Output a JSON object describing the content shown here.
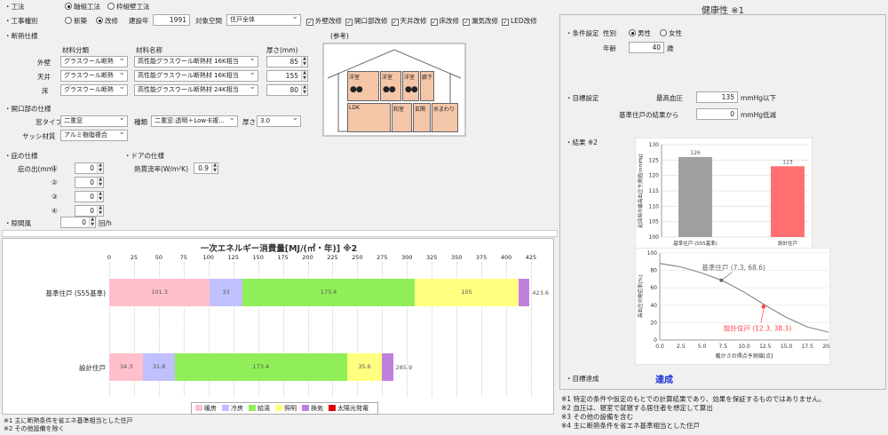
{
  "construction": {
    "label": "工法",
    "options": [
      "軸組工法",
      "枠組壁工法"
    ],
    "selected": 0
  },
  "work_type": {
    "label": "工事種別",
    "options": [
      "新築",
      "改修"
    ],
    "selected": 1,
    "year_label": "建設年",
    "year_value": "1991",
    "space_label": "対象空間",
    "space_value": "住戸全体",
    "checks": [
      {
        "label": "外壁改修",
        "checked": true
      },
      {
        "label": "開口部改修",
        "checked": true
      },
      {
        "label": "天井改修",
        "checked": true
      },
      {
        "label": "床改修",
        "checked": true
      },
      {
        "label": "漏気改修",
        "checked": true
      },
      {
        "label": "LED改修",
        "checked": true
      }
    ]
  },
  "insulation": {
    "title": "断熱仕様",
    "col_material_type": "材料分類",
    "col_material_name": "材料名称",
    "col_thickness": "厚さ(mm)",
    "reference": "(参考)",
    "rows": [
      {
        "label": "外壁",
        "type": "グラスウール断熱材",
        "name": "高性能グラスウール断熱材 16K相当",
        "thickness": "85"
      },
      {
        "label": "天井",
        "type": "グラスウール断熱材",
        "name": "高性能グラスウール断熱材 16K相当",
        "thickness": "155"
      },
      {
        "label": "床",
        "type": "グラスウール断熱材",
        "name": "高性能グラスウール断熱材 24K相当",
        "thickness": "80"
      }
    ]
  },
  "opening": {
    "title": "開口部の仕様",
    "window_type_label": "窓タイプ",
    "window_type_value": "二重窓",
    "kind_label": "種類",
    "kind_value": "二重窓:透明＋Low-E複...",
    "thickness_label": "厚さ",
    "thickness_value": "3.0",
    "sash_label": "サッシ材質",
    "sash_value": "アルミ樹脂複合"
  },
  "eaves": {
    "title": "庇の仕様",
    "depth_label": "庇の出(mm)",
    "rows": [
      {
        "label": "①",
        "value": "0"
      },
      {
        "label": "②",
        "value": "0"
      },
      {
        "label": "③",
        "value": "0"
      },
      {
        "label": "④",
        "value": "0"
      }
    ]
  },
  "door": {
    "title": "ドアの仕様",
    "heat_label": "熱貫流率(W/m²K)",
    "heat_value": "0.9"
  },
  "draft": {
    "label": "隙間風",
    "value": "0",
    "unit": "回/h"
  },
  "house_rooms": {
    "upper": [
      "洋室",
      "洋室",
      "洋室",
      "廊下"
    ],
    "lower": [
      "LDK",
      "和室",
      "玄関",
      "水まわり"
    ]
  },
  "energy_chart": {
    "title": "一次エネルギー消費量[MJ/(㎡・年)] ※2",
    "ticks": [
      "0",
      "25",
      "50",
      "75",
      "100",
      "125",
      "150",
      "175",
      "200",
      "225",
      "250",
      "275",
      "300",
      "325",
      "350",
      "375",
      "400",
      "425"
    ],
    "rows": [
      {
        "label": "基準住戸 (S55基準)",
        "total_label": "423.6",
        "segments": [
          {
            "value": 101.3,
            "label": "101.3"
          },
          {
            "value": 33,
            "label": "33"
          },
          {
            "value": 173.4,
            "label": "173.4"
          },
          {
            "value": 105,
            "label": "105"
          },
          {
            "value": 10.9,
            "label": ""
          },
          {
            "value": 0,
            "label": ""
          }
        ]
      },
      {
        "label": "設計住戸",
        "total_label": "285.9",
        "segments": [
          {
            "value": 34.3,
            "label": "34.3"
          },
          {
            "value": 31.8,
            "label": "31.8"
          },
          {
            "value": 173.4,
            "label": "173.4"
          },
          {
            "value": 35.6,
            "label": "35.6"
          },
          {
            "value": 10.8,
            "label": ""
          },
          {
            "value": 0,
            "label": ""
          }
        ]
      }
    ],
    "legend": [
      {
        "name": "暖房",
        "color": "#ffc0cb"
      },
      {
        "name": "冷房",
        "color": "#c0c0ff"
      },
      {
        "name": "給湯",
        "color": "#90ee58"
      },
      {
        "name": "照明",
        "color": "#ffff80"
      },
      {
        "name": "換気",
        "color": "#c080e0"
      },
      {
        "name": "太陽光発電",
        "color": "#e00000"
      }
    ]
  },
  "footnotes_left": [
    "※1 主に断熱条件を省エネ基準相当とした住戸",
    "※2 その他設備を除く"
  ],
  "health": {
    "title": "健康性 ※1",
    "conditions_label": "・条件設定",
    "sex_label": "性別",
    "sex_options": [
      "男性",
      "女性"
    ],
    "sex_selected": 0,
    "age_label": "年齢",
    "age_value": "40",
    "age_unit": "歳",
    "target_label": "・目標設定",
    "max_bp_label": "最高血圧",
    "max_bp_value": "135",
    "max_bp_unit": "mmHg以下",
    "reduce_label": "基準住戸の結果から",
    "reduce_value": "0",
    "reduce_unit": "mmHg低減",
    "result_label": "・結果 ※2",
    "achieve_label": "・目標達成",
    "achieve_value": "達成",
    "footnotes": [
      "※1 特定の条件や仮定のもとでの計算結果であり、効果を保証するものではありません。",
      "※2 血圧は、寝室で就寝する居住者を想定して算出",
      "※3 その他の設備を含む",
      "※4 主に断熱条件を省エネ基準相当とした住戸"
    ]
  },
  "chart_data": [
    {
      "type": "bar",
      "title": "一次エネルギー消費量[MJ/(㎡・年)] ※2",
      "orientation": "horizontal-stacked",
      "categories": [
        "基準住戸 (S55基準)",
        "設計住戸"
      ],
      "series": [
        {
          "name": "暖房",
          "values": [
            101.3,
            34.3
          ]
        },
        {
          "name": "冷房",
          "values": [
            33,
            31.8
          ]
        },
        {
          "name": "給湯",
          "values": [
            173.4,
            173.4
          ]
        },
        {
          "name": "照明",
          "values": [
            105,
            35.6
          ]
        },
        {
          "name": "換気",
          "values": [
            10.9,
            10.8
          ]
        },
        {
          "name": "太陽光発電",
          "values": [
            0,
            0
          ]
        }
      ],
      "totals": [
        423.6,
        285.9
      ],
      "xlim": [
        0,
        425
      ],
      "legend": "bottom"
    },
    {
      "type": "bar",
      "title": "",
      "categories": [
        "基準住戸 (S55基準)",
        "設計住戸"
      ],
      "values": [
        126,
        123
      ],
      "colors": [
        "#a0a0a0",
        "#ff7070"
      ],
      "ylabel": "起床時の最高血圧予測値[mmHg]",
      "ylim": [
        100,
        130
      ],
      "yticks": [
        100,
        105,
        110,
        115,
        120,
        125,
        130
      ]
    },
    {
      "type": "line",
      "title": "",
      "xlabel": "暖かさの得点予測値[点]",
      "ylabel": "高血圧の発症率[%]",
      "xlim": [
        0,
        20
      ],
      "ylim": [
        0,
        100
      ],
      "xticks": [
        "0.0",
        "2.5",
        "5.0",
        "7.5",
        "10.0",
        "12.5",
        "15.0",
        "17.5",
        "20.0"
      ],
      "yticks": [
        "0",
        "20",
        "40",
        "60",
        "80",
        "100"
      ],
      "x": [
        0,
        2.5,
        5,
        7.5,
        10,
        12.5,
        15,
        17.5,
        20
      ],
      "y": [
        88,
        84,
        77,
        68,
        55,
        40,
        26,
        15,
        9
      ],
      "annotations": [
        {
          "label": "基準住戸 (7.3, 68.6)",
          "x": 7.3,
          "y": 68.6,
          "color": "#666666"
        },
        {
          "label": "設計住戸 (12.3, 38.3)",
          "x": 12.3,
          "y": 38.3,
          "color": "#ff4040"
        }
      ]
    }
  ]
}
